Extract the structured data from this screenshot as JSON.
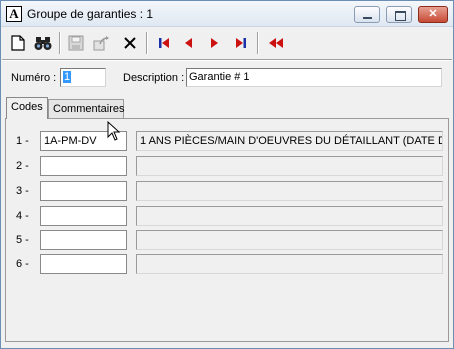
{
  "window": {
    "title": "Groupe de garanties : 1",
    "app_icon_letter": "A"
  },
  "toolbar": {
    "buttons": [
      "new-icon",
      "binoculars-icon",
      "save-icon",
      "export-icon",
      "delete-icon",
      "first-icon",
      "previous-icon",
      "next-icon",
      "last-icon",
      "rewind-icon"
    ]
  },
  "form": {
    "numero_label": "Numéro :",
    "numero_value": "1",
    "description_label": "Description :",
    "description_value": "Garantie # 1"
  },
  "tabs": [
    {
      "label": "Codes",
      "active": true
    },
    {
      "label": "Commentaires",
      "active": false
    }
  ],
  "rows": [
    {
      "num": "1 -",
      "code": "1A-PM-DV",
      "description": "1 ANS PIÈCES/MAIN D'OEUVRES DU DÉTAILLANT (DATE D"
    },
    {
      "num": "2 -",
      "code": "",
      "description": ""
    },
    {
      "num": "3 -",
      "code": "",
      "description": ""
    },
    {
      "num": "4 -",
      "code": "",
      "description": ""
    },
    {
      "num": "5 -",
      "code": "",
      "description": ""
    },
    {
      "num": "6 -",
      "code": "",
      "description": ""
    }
  ],
  "colors": {
    "nav_red": "#cc1111",
    "nav_blue": "#1a2fa8",
    "selection": "#3399ff"
  }
}
